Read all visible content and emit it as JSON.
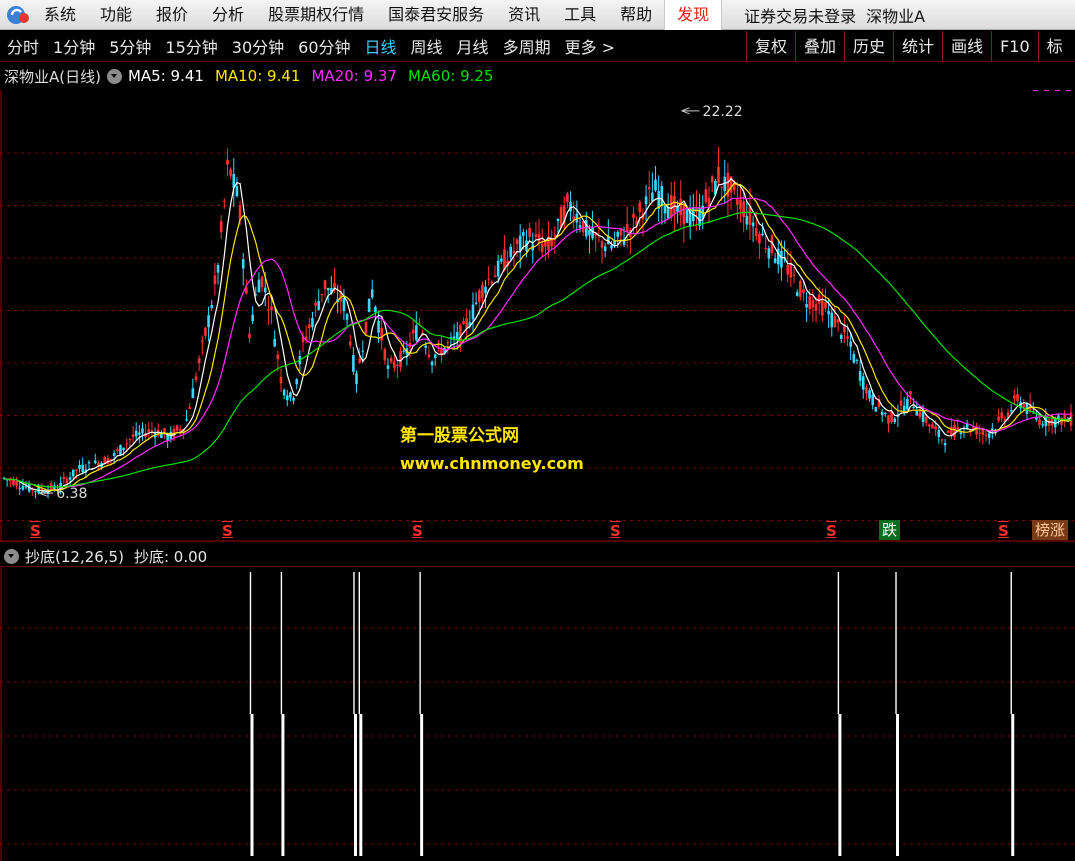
{
  "menubar": {
    "items": [
      "系统",
      "功能",
      "报价",
      "分析",
      "股票期权行情",
      "国泰君安服务",
      "资讯",
      "工具",
      "帮助"
    ],
    "active_item": "发现",
    "status": "证券交易未登录",
    "stock": "深物业A"
  },
  "toolbar": {
    "periods": [
      "分时",
      "1分钟",
      "5分钟",
      "15分钟",
      "30分钟",
      "60分钟",
      "日线",
      "周线",
      "月线",
      "多周期",
      "更多 >"
    ],
    "active_period": "日线",
    "tools": [
      "复权",
      "叠加",
      "历史",
      "统计",
      "画线",
      "F10",
      "标"
    ]
  },
  "chart_header": {
    "title": "深物业A(日线)",
    "ma": [
      {
        "label": "MA5:",
        "value": "9.41",
        "color": "#ffffff"
      },
      {
        "label": "MA10:",
        "value": "9.41",
        "color": "#ffe600"
      },
      {
        "label": "MA20:",
        "value": "9.37",
        "color": "#ff2bff"
      },
      {
        "label": "MA60:",
        "value": "9.25",
        "color": "#00e000"
      }
    ]
  },
  "colors": {
    "up": "#ff3030",
    "down": "#39d9ff",
    "ma5": "#ffffff",
    "ma10": "#ffe600",
    "ma20": "#ff2bff",
    "ma60": "#00e000",
    "grid": "#7a0000"
  },
  "price_labels": {
    "high": "22.22",
    "low": "6.38"
  },
  "signals": {
    "s_label": "S",
    "fall_label": "跌",
    "rank_label": "榜涨"
  },
  "indicator": {
    "name": "抄底(12,26,5)",
    "value_label": "抄底: 0.00"
  },
  "watermark": {
    "line1": "第一股票公式网",
    "line2": "www.chnmoney.com"
  },
  "chart_data": {
    "type": "candlestick",
    "series": [
      {
        "name": "MA5",
        "value": 9.41
      },
      {
        "name": "MA10",
        "value": 9.41
      },
      {
        "name": "MA20",
        "value": 9.37
      },
      {
        "name": "MA60",
        "value": 9.25
      }
    ],
    "price_high": 22.22,
    "price_low": 6.38,
    "grid": true,
    "indicator": {
      "name": "抄底(12,26,5)",
      "current": 0.0,
      "spikes": [
        {
          "bar": 0.231,
          "value": 1.0
        },
        {
          "bar": 0.26,
          "value": 1.0
        },
        {
          "bar": 0.328,
          "value": 1.0
        },
        {
          "bar": 0.333,
          "value": 1.0
        },
        {
          "bar": 0.39,
          "value": 1.0
        },
        {
          "bar": 0.782,
          "value": 1.0
        },
        {
          "bar": 0.836,
          "value": 1.0
        },
        {
          "bar": 0.944,
          "value": 1.0
        }
      ]
    }
  }
}
